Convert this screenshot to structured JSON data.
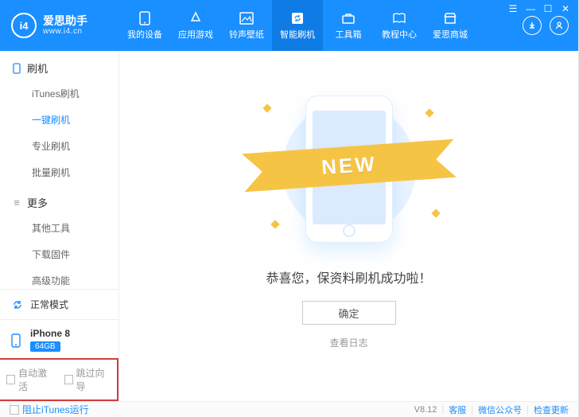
{
  "app": {
    "title": "爱思助手",
    "url": "www.i4.cn",
    "logo_text": "i4"
  },
  "topnav": [
    {
      "label": "我的设备"
    },
    {
      "label": "应用游戏"
    },
    {
      "label": "铃声壁纸"
    },
    {
      "label": "智能刷机"
    },
    {
      "label": "工具箱"
    },
    {
      "label": "教程中心"
    },
    {
      "label": "爱思商城"
    }
  ],
  "sidebar": {
    "sections": [
      {
        "title": "刷机",
        "items": [
          "iTunes刷机",
          "一键刷机",
          "专业刷机",
          "批量刷机"
        ],
        "active_index": 1
      },
      {
        "title": "更多",
        "items": [
          "其他工具",
          "下载固件",
          "高级功能"
        ]
      }
    ],
    "mode": "正常模式",
    "device": {
      "name": "iPhone 8",
      "storage": "64GB"
    },
    "options": {
      "auto_activate": "自动激活",
      "skip_guide": "跳过向导"
    }
  },
  "main": {
    "ribbon": "NEW",
    "message": "恭喜您，保资料刷机成功啦！",
    "confirm": "确定",
    "view_log": "查看日志"
  },
  "footer": {
    "block_itunes": "阻止iTunes运行",
    "version": "V8.12",
    "support": "客服",
    "wechat": "微信公众号",
    "check_update": "检查更新"
  }
}
